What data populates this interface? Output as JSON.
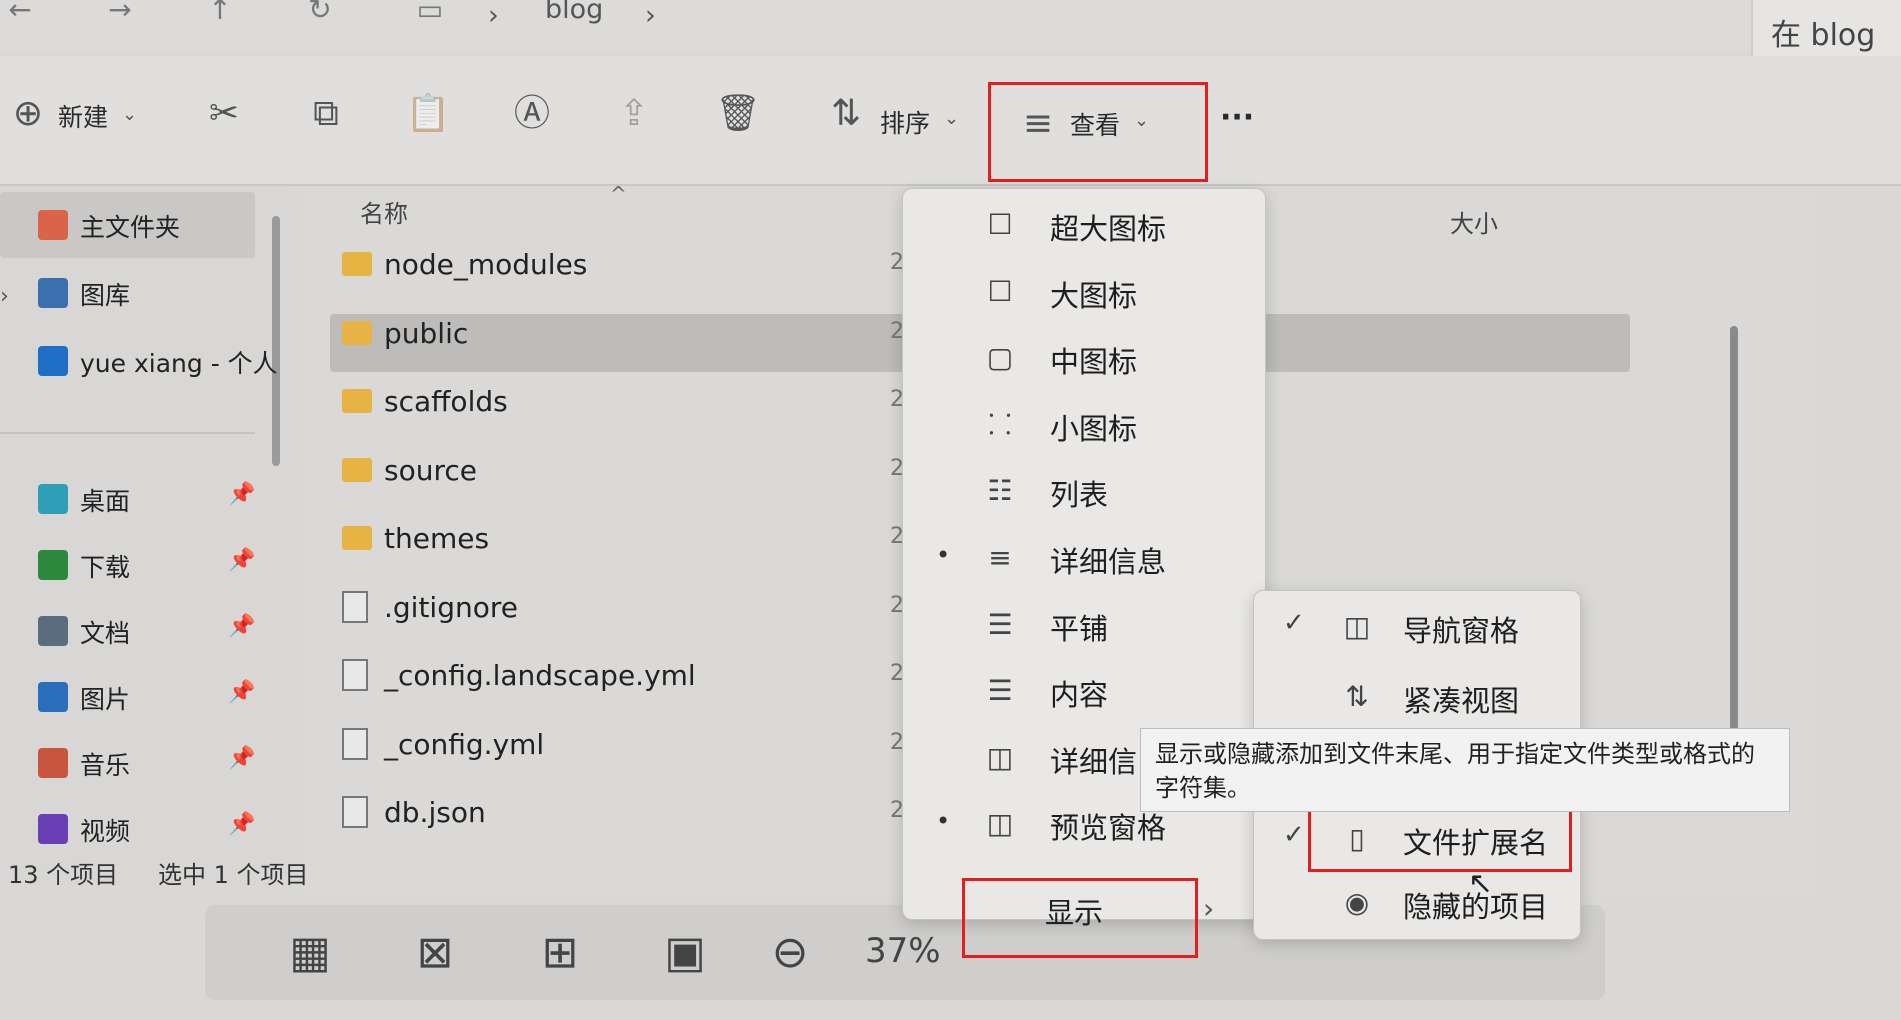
{
  "address": {
    "crumb": "blog",
    "search_text": "在 blog",
    "nav": {
      "back": "←",
      "forward": "→",
      "up": "↑",
      "refresh": "↻",
      "computer": "▭",
      "sep": "›"
    }
  },
  "toolbar": {
    "new_label": "新建",
    "sort_label": "排序",
    "view_label": "查看",
    "more_label": "···",
    "icons": {
      "new": "⊕",
      "cut": "✂",
      "copy": "⧉",
      "paste": "📋",
      "rename": "Ⓐ",
      "share": "⇪",
      "delete": "🗑",
      "sort": "⇅",
      "view": "≡"
    }
  },
  "sidebar": {
    "items": [
      {
        "label": "主文件夹",
        "icon": "home-icon",
        "color": "#d9644a"
      },
      {
        "label": "图库",
        "icon": "gallery-icon",
        "color": "#3a6fb0"
      },
      {
        "label": "yue xiang - 个人",
        "icon": "cloud-icon",
        "color": "#1f6fc7"
      },
      {
        "label": "桌面",
        "icon": "desktop-icon",
        "color": "#2f9fb8"
      },
      {
        "label": "下载",
        "icon": "download-icon",
        "color": "#2b8a3e"
      },
      {
        "label": "文档",
        "icon": "documents-icon",
        "color": "#5b6c7e"
      },
      {
        "label": "图片",
        "icon": "pictures-icon",
        "color": "#2a6dbd"
      },
      {
        "label": "音乐",
        "icon": "music-icon",
        "color": "#c8553d"
      },
      {
        "label": "视频",
        "icon": "video-icon",
        "color": "#6a3fb5"
      }
    ],
    "pin": "📌"
  },
  "filelist": {
    "col_name": "名称",
    "col_size": "大小",
    "rows": [
      {
        "name": "node_modules",
        "type": "folder"
      },
      {
        "name": "public",
        "type": "folder"
      },
      {
        "name": "scaffolds",
        "type": "folder"
      },
      {
        "name": "source",
        "type": "folder"
      },
      {
        "name": "themes",
        "type": "folder"
      },
      {
        "name": ".gitignore",
        "type": "file"
      },
      {
        "name": "_config.landscape.yml",
        "type": "file"
      },
      {
        "name": "_config.yml",
        "type": "file"
      },
      {
        "name": "db.json",
        "type": "file"
      }
    ],
    "date_prefix": "2"
  },
  "status": {
    "count": "13 个项目",
    "selected": "选中 1 个项目"
  },
  "view_menu": {
    "items": [
      {
        "label": "超大图标",
        "icon": "☐",
        "dot": ""
      },
      {
        "label": "大图标",
        "icon": "☐",
        "dot": ""
      },
      {
        "label": "中图标",
        "icon": "▢",
        "dot": ""
      },
      {
        "label": "小图标",
        "icon": "⸬",
        "dot": ""
      },
      {
        "label": "列表",
        "icon": "☷",
        "dot": ""
      },
      {
        "label": "详细信息",
        "icon": "≡",
        "dot": "•"
      },
      {
        "label": "平铺",
        "icon": "☰",
        "dot": ""
      },
      {
        "label": "内容",
        "icon": "☰",
        "dot": ""
      },
      {
        "label": "详细信",
        "icon": "◫",
        "dot": ""
      },
      {
        "label": "预览窗格",
        "icon": "◫",
        "dot": "•"
      }
    ],
    "show_label": "显示",
    "show_arrow": "›"
  },
  "show_menu": {
    "items": [
      {
        "label": "导航窗格",
        "icon": "◫",
        "check": "✓"
      },
      {
        "label": "紧凑视图",
        "icon": "⇅",
        "check": ""
      },
      {
        "label": "文件扩展名",
        "icon": "▯",
        "check": "✓"
      },
      {
        "label": "隐藏的项目",
        "icon": "◉",
        "check": ""
      }
    ]
  },
  "tooltip": {
    "text": "显示或隐藏添加到文件末尾、用于指定文件类型或格式的字符集。"
  },
  "viewer": {
    "zoom": "37%",
    "icons": [
      "▦",
      "⊠",
      "⊞",
      "▣",
      "⊖"
    ]
  }
}
